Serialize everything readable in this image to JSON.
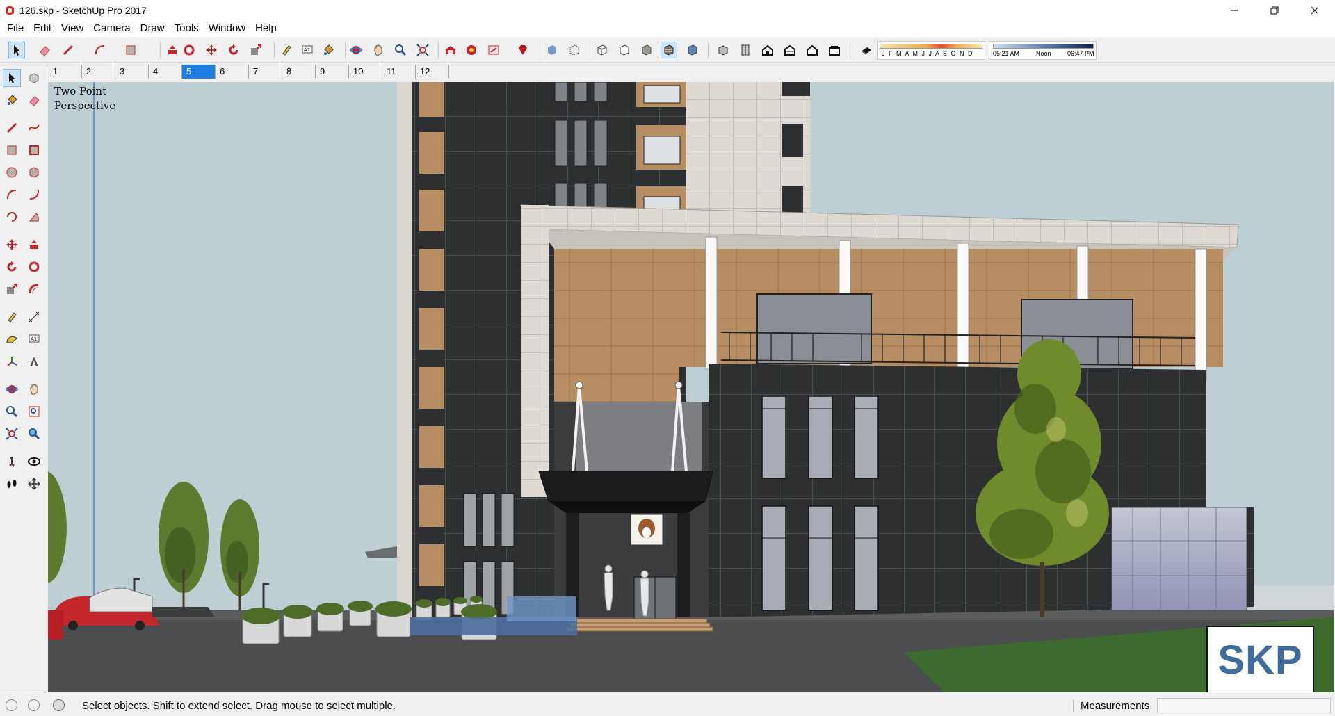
{
  "window": {
    "title": "126.skp - SketchUp Pro 2017"
  },
  "menu": [
    "File",
    "Edit",
    "View",
    "Camera",
    "Draw",
    "Tools",
    "Window",
    "Help"
  ],
  "shadow": {
    "months": "J F M A M J J A S O N D",
    "time_start": "05:21 AM",
    "time_mid": "Noon",
    "time_end": "06:47 PM"
  },
  "scenes": {
    "tabs": [
      "1",
      "2",
      "3",
      "4",
      "5",
      "6",
      "7",
      "8",
      "9",
      "10",
      "11",
      "12"
    ],
    "active_index": 4
  },
  "viewport": {
    "camera_line1": "Two Point",
    "camera_line2": "Perspective",
    "watermark": "SKP"
  },
  "status": {
    "hint": "Select objects. Shift to extend select. Drag mouse to select multiple.",
    "measurements_label": "Measurements",
    "measurements_value": ""
  },
  "colors": {
    "active_blue": "#1f7ee4",
    "sky": "#bdcfd3",
    "wood": "#b78e63",
    "dark_wall": "#2d2f31",
    "concrete": "#dedad3",
    "skp_blue": "#3f6c9a"
  },
  "icons": {
    "toolbar": [
      "select-icon",
      "eraser-icon",
      "pencil-icon",
      "arc-icon",
      "rectangle-icon",
      "push-pull-icon",
      "follow-me-icon",
      "move-icon",
      "rotate-icon",
      "scale-icon",
      "tape-measure-icon",
      "text-icon",
      "paint-bucket-icon",
      "orbit-icon",
      "pan-icon",
      "zoom-icon",
      "zoom-extents-icon",
      "warehouse-icon",
      "extension-warehouse-icon",
      "layout-icon",
      "ruby-icon",
      "xray-icon",
      "back-edges-icon",
      "wireframe-icon",
      "hidden-line-icon",
      "shaded-icon",
      "shaded-textures-icon",
      "monochrome-icon",
      "iso-view-icon",
      "top-view-icon",
      "front-view-icon",
      "right-view-icon",
      "back-view-icon",
      "left-view-icon",
      "shadow-toggle-icon"
    ]
  }
}
